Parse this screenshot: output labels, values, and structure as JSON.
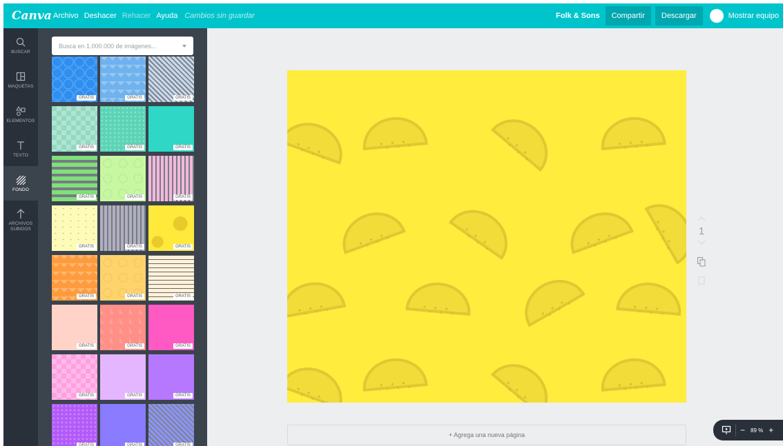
{
  "topbar": {
    "logo": "Canva",
    "menu": [
      {
        "label": "Archivo",
        "state": "normal"
      },
      {
        "label": "Deshacer",
        "state": "normal"
      },
      {
        "label": "Rehacer",
        "state": "dim"
      },
      {
        "label": "Ayuda",
        "state": "normal"
      }
    ],
    "status": "Cambios sin guardar",
    "team_name": "Folk & Sons",
    "share_label": "Compartir",
    "download_label": "Descargar",
    "show_team_label": "Mostrar equipo"
  },
  "rail": {
    "items": [
      {
        "label": "BUSCAR",
        "icon": "search-icon"
      },
      {
        "label": "MAQUETAS",
        "icon": "layout-icon"
      },
      {
        "label": "ELEMENTOS",
        "icon": "shapes-icon"
      },
      {
        "label": "TEXTO",
        "icon": "text-icon"
      },
      {
        "label": "FONDO",
        "icon": "background-icon",
        "active": true
      },
      {
        "label": "ARCHIVOS SUBIDOS",
        "icon": "upload-icon"
      }
    ]
  },
  "panel": {
    "search_placeholder": "Busca en 1.000.000 de imágenes...",
    "badge": "GRATIS",
    "tiles": [
      {
        "color": "#2f8ff0",
        "pattern": "hex"
      },
      {
        "color": "#6fb2ee",
        "pattern": "zigzag"
      },
      {
        "color": "#c8d9ef",
        "pattern": "diag"
      },
      {
        "color": "#93d9c1",
        "pattern": "diamond"
      },
      {
        "color": "#5bd4b6",
        "pattern": "dots"
      },
      {
        "color": "#2ed7c6",
        "pattern": "plain"
      },
      {
        "color": "#7fe07a",
        "pattern": "hstripes"
      },
      {
        "color": "#c7f7a1",
        "pattern": "circles"
      },
      {
        "color": "#f3b8dd",
        "pattern": "vstripes"
      },
      {
        "color": "#fdfbb7",
        "pattern": "speckle"
      },
      {
        "color": "#b1afc1",
        "pattern": "vstripes"
      },
      {
        "color": "#ffe93b",
        "pattern": "melon"
      },
      {
        "color": "#ff9b3d",
        "pattern": "zigzag"
      },
      {
        "color": "#ffd36c",
        "pattern": "circles"
      },
      {
        "color": "#fff1dc",
        "pattern": "hlines"
      },
      {
        "color": "#ffd3c8",
        "pattern": "plain"
      },
      {
        "color": "#ff8f87",
        "pattern": "triangles"
      },
      {
        "color": "#ff59c4",
        "pattern": "plain"
      },
      {
        "color": "#ff9fe0",
        "pattern": "diamond"
      },
      {
        "color": "#e3b6ff",
        "pattern": "plain"
      },
      {
        "color": "#b678ff",
        "pattern": "plain"
      },
      {
        "color": "#b35bfa",
        "pattern": "dots"
      },
      {
        "color": "#8a7bff",
        "pattern": "plain"
      },
      {
        "color": "#8c93ff",
        "pattern": "diag"
      }
    ]
  },
  "canvas": {
    "page_number": "1",
    "add_page_label": "+ Agrega una nueva página",
    "background_color": "#ffec3d"
  },
  "zoom": {
    "value": "89 %",
    "minus": "−",
    "plus": "+"
  }
}
